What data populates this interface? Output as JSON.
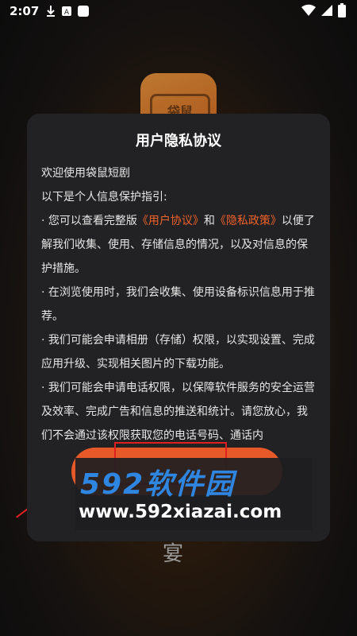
{
  "status_bar": {
    "time": "2:07",
    "icons": [
      "download-icon",
      "a-box-icon",
      "square-icon"
    ],
    "right_icons": [
      "wifi-icon",
      "signal-icon",
      "battery-icon"
    ]
  },
  "app_logo": {
    "text": "袋鼠"
  },
  "dialog": {
    "title": "用户隐私协议",
    "intro1": "欢迎使用袋鼠短剧",
    "intro2": "以下是个人信息保护指引:",
    "p1_a": "· 您可以查看完整版",
    "p1_link1": "《用户协议》",
    "p1_and": "和",
    "p1_link2": "《隐私政策》",
    "p1_b": "以便了解我们收集、使用、存储信息的情况，以及对信息的保护措施。",
    "p2": "· 在浏览使用时，我们会收集、使用设备标识信息用于推荐。",
    "p3": "· 我们可能会申请相册（存储）权限，以实现设置、完成应用升级、实现相关图片的下载功能。",
    "p4": "· 我们可能会申请电话权限，以保障软件服务的安全运营及效率、完成广告和信息的推送和统计。请您放心，我们不会通过该权限获取您的电话号码、通话内"
  },
  "watermark": {
    "big": "592软件园",
    "url": "www.592xiazai.com"
  },
  "bottom_text": "宴",
  "colors": {
    "accent": "#e8592a",
    "link": "#f0622a",
    "dialog_bg": "#222224",
    "watermark_blue": "#2f86e0"
  }
}
